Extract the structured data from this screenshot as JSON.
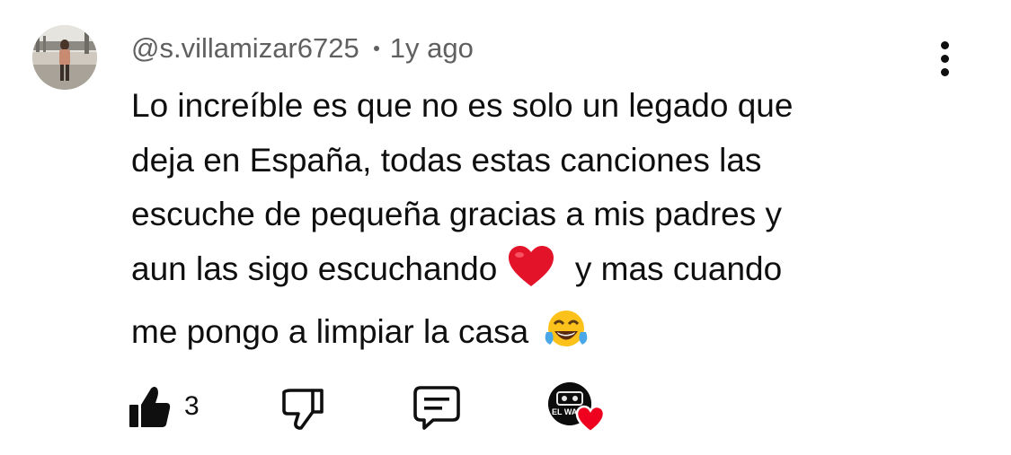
{
  "comment": {
    "author": "@s.villamizar6725",
    "time": "1y ago",
    "text_lines": [
      "Lo increíble es que no es solo un legado que",
      "deja en España, todas estas canciones las",
      "escuche de pequeña gracias a mis padres y",
      "aun las sigo escuchando",
      "y mas cuando",
      "me pongo a limpiar la casa"
    ],
    "like_count": "3",
    "creator_avatar_text": "EL WALK"
  },
  "icons": {
    "more": "more-vert-icon",
    "like": "thumbs-up-icon",
    "dislike": "thumbs-down-icon",
    "reply": "reply-comment-icon",
    "creator_heart": "heart-icon"
  },
  "colors": {
    "text": "#0f0f0f",
    "meta": "#606060",
    "heart": "#f0001f"
  }
}
